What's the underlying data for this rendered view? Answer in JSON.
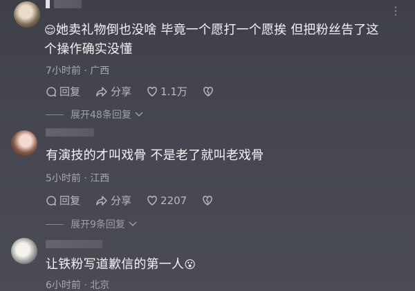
{
  "comments": [
    {
      "text_line1": "她卖礼物倒也没啥  毕竟一个愿打一个愿挨   但把粉丝告了这",
      "text_line2": "个操作确实没懂",
      "emoji": "😌",
      "time_location": "7小时前 · 广西",
      "reply_label": "回复",
      "share_label": "分享",
      "like_count": "1.1万",
      "expand_label": "展开48条回复"
    },
    {
      "text_line1": "有演技的才叫戏骨 不是老了就叫老戏骨",
      "time_location": "5小时前 · 江西",
      "reply_label": "回复",
      "share_label": "分享",
      "like_count": "2207",
      "expand_label": "展开9条回复"
    },
    {
      "text_line1": "让铁粉写道歉信的第一人",
      "emoji": "😮",
      "time_location": "6小时前 · 北京"
    }
  ],
  "colors": {
    "text": "#f4f4f6",
    "meta": "#a7a8b0",
    "background": "#45464f"
  },
  "icons": [
    "comment-icon",
    "share-icon",
    "heart-icon",
    "dislike-heart-icon",
    "chevron-down-icon",
    "more-icon"
  ]
}
